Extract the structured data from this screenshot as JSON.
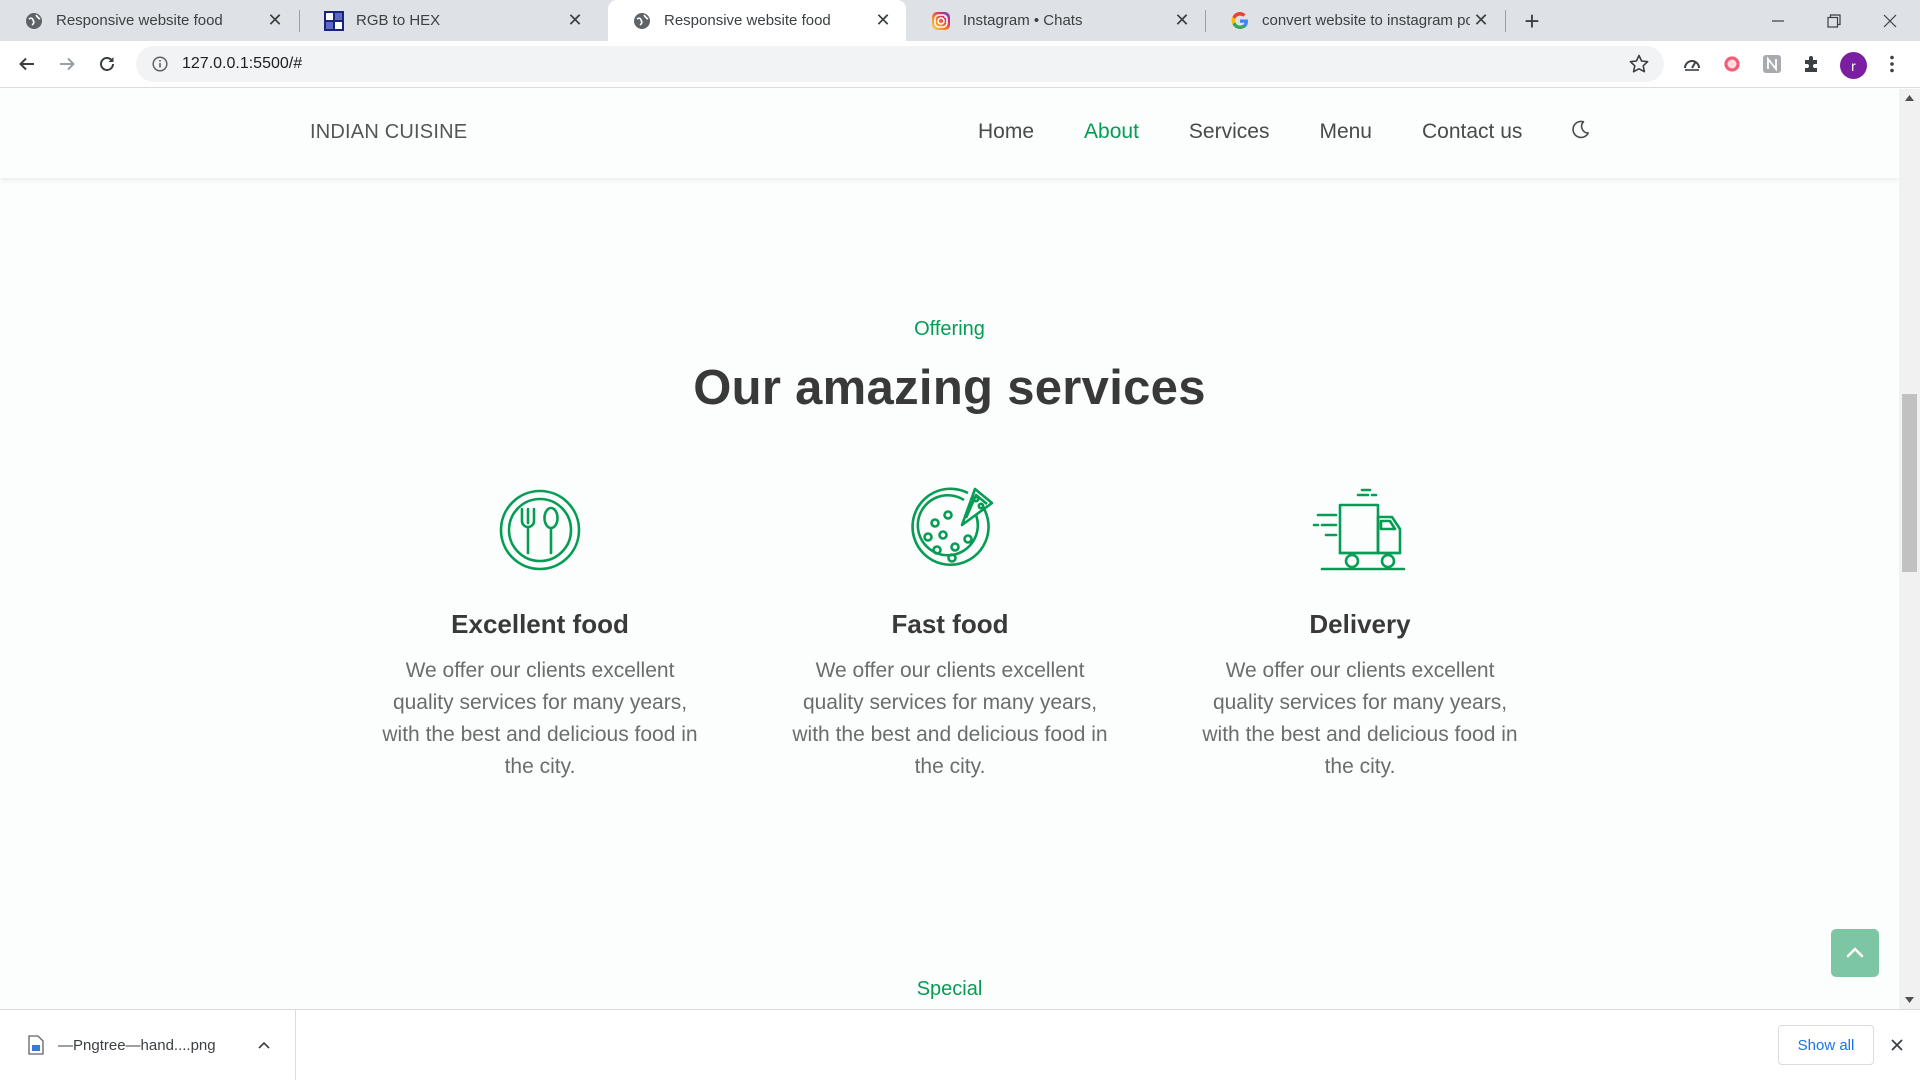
{
  "browser": {
    "tabs": [
      {
        "title": "Responsive website food",
        "favicon": "globe-icon",
        "active": false
      },
      {
        "title": "RGB to HEX",
        "favicon": "rgbtohex-icon",
        "active": false
      },
      {
        "title": "Responsive website food",
        "favicon": "globe-icon",
        "active": true
      },
      {
        "title": "Instagram • Chats",
        "favicon": "instagram-icon",
        "active": false
      },
      {
        "title": "convert website to instagram pos",
        "favicon": "google-icon",
        "active": false
      }
    ],
    "url": "127.0.0.1:5500/#",
    "profile_initial": "r",
    "profile_color": "#7b1fa2"
  },
  "site": {
    "logo": "INDIAN CUISINE",
    "nav": [
      "Home",
      "About",
      "Services",
      "Menu",
      "Contact us"
    ],
    "active_nav": "About",
    "accent_color": "#069c54"
  },
  "services": {
    "subtitle": "Offering",
    "title": "Our amazing services",
    "items": [
      {
        "title": "Excellent food",
        "icon": "plate-cutlery-icon",
        "description": "We offer our clients excellent quality services for many years, with the best and delicious food in the city."
      },
      {
        "title": "Fast food",
        "icon": "pizza-icon",
        "description": "We offer our clients excellent quality services for many years, with the best and delicious food in the city."
      },
      {
        "title": "Delivery",
        "icon": "delivery-truck-icon",
        "description": "We offer our clients excellent quality services for many years, with the best and delicious food in the city."
      }
    ]
  },
  "next_section": {
    "subtitle": "Special"
  },
  "downloads": {
    "filename": "—Pngtree—hand....png",
    "show_all": "Show all"
  }
}
